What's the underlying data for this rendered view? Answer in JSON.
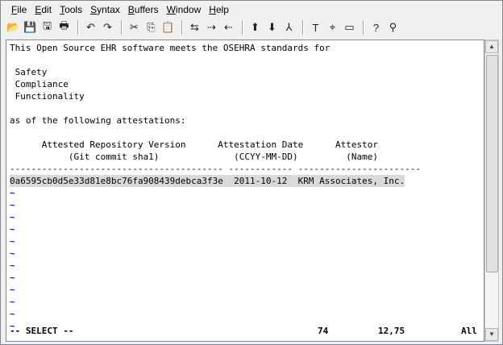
{
  "menu": [
    "File",
    "Edit",
    "Tools",
    "Syntax",
    "Buffers",
    "Window",
    "Help"
  ],
  "menu_underline": [
    "F",
    "E",
    "T",
    "S",
    "B",
    "W",
    "H"
  ],
  "menu_rest": [
    "ile",
    "dit",
    "ools",
    "yntax",
    "uffers",
    "indow",
    "elp"
  ],
  "toolbar": {
    "icons": [
      "open-icon",
      "save-icon",
      "save-all-icon",
      "print-icon",
      "undo-icon",
      "redo-icon",
      "cut-icon",
      "copy-icon",
      "paste-icon",
      "replace-icon",
      "find-next-icon",
      "find-prev-icon",
      "load-session-icon",
      "save-session-icon",
      "run-script-icon",
      "make-icon",
      "run-ctags-icon",
      "jump-tag-icon",
      "help-icon",
      "find-help-icon"
    ],
    "glyphs": [
      "📂",
      "💾",
      "🖫",
      "🖶",
      "↶",
      "↷",
      "✂",
      "⎘",
      "📋",
      "⇆",
      "⇢",
      "⇠",
      "⬆",
      "⬇",
      "⅄",
      "T",
      "⌖",
      "▭",
      "?",
      "⚲"
    ]
  },
  "editor": {
    "lines": [
      "This Open Source EHR software meets the OSEHRA standards for",
      "",
      " Safety",
      " Compliance",
      " Functionality",
      "",
      "as of the following attestations:",
      "",
      "      Attested Repository Version      Attestation Date      Attestor",
      "           (Git commit sha1)              (CCYY-MM-DD)         (Name)",
      "---------------------------------------- ------------ -----------------------",
      "0a6595cb0d5e33d81e8bc76fa908439debca3f3e  2011-10-12  KRM Associates, Inc."
    ],
    "tilde": "~",
    "tilde_count": 12
  },
  "statusline": {
    "mode": "-- SELECT --",
    "selected": "74",
    "position": "12,75",
    "scroll": "All"
  }
}
